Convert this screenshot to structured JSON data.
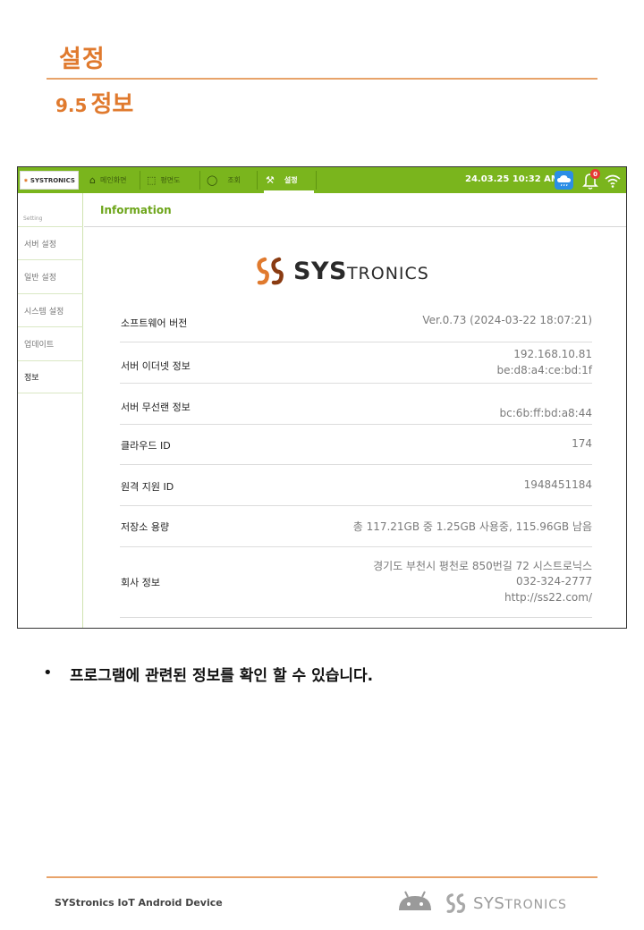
{
  "document": {
    "title": "설정",
    "section_number": "9.5",
    "section_title": "정보",
    "bullet_text": "프로그램에 관련된 정보를 확인 할 수 있습니다.",
    "footer_text": "SYStronics IoT Android Device",
    "footer_logo_text": {
      "big": "SYS",
      "small": "TRONICS"
    }
  },
  "app": {
    "logo_text": "SYSTRONICS",
    "nav": [
      {
        "label": "메인화면",
        "icon": "home-icon"
      },
      {
        "label": "평면도",
        "icon": "floorplan-icon"
      },
      {
        "label": "조회",
        "icon": "search-icon"
      },
      {
        "label": "설정",
        "icon": "tools-icon",
        "active": true
      }
    ],
    "datetime": "24.03.25 10:32 AM",
    "notification_count": "0",
    "accent_color": "#7ab51d",
    "brand_color": "#e07a2e"
  },
  "sidebar": {
    "caption": "Setting",
    "items": [
      {
        "label": "서버 설정"
      },
      {
        "label": "일반 설정"
      },
      {
        "label": "시스템 설정"
      },
      {
        "label": "업데이트"
      },
      {
        "label": "정보",
        "selected": true
      }
    ]
  },
  "content": {
    "title": "Information",
    "brand": {
      "big": "SYS",
      "small": "TRONICS"
    },
    "rows": [
      {
        "label": "소프트웨어 버전",
        "values": [
          "Ver.0.73 (2024-03-22 18:07:21)"
        ]
      },
      {
        "label": "서버 이더넷 정보",
        "values": [
          "192.168.10.81",
          "be:d8:a4:ce:bd:1f"
        ]
      },
      {
        "label": "서버 무선랜 정보",
        "values": [
          "bc:6b:ff:bd:a8:44"
        ]
      },
      {
        "label": "클라우드 ID",
        "values": [
          "174"
        ]
      },
      {
        "label": "원격 지원 ID",
        "values": [
          "1948451184"
        ]
      },
      {
        "label": "저장소 용량",
        "values": [
          "총 117.21GB 중 1.25GB 사용중, 115.96GB 남음"
        ]
      },
      {
        "label": "회사 정보",
        "values": [
          "경기도 부천시 평천로 850번길 72 시스트로닉스",
          "032-324-2777",
          "http://ss22.com/"
        ]
      }
    ]
  }
}
